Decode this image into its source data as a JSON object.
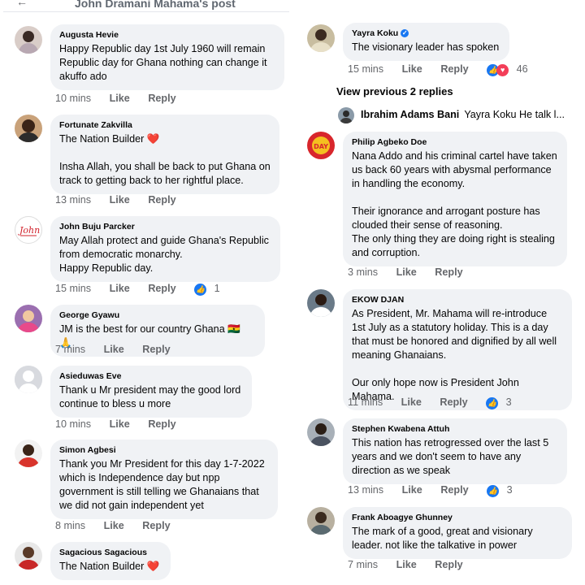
{
  "left_panel": {
    "header_title": "John Dramani Mahama's post",
    "comments": [
      {
        "name": "Augusta Hevie",
        "text": "Happy  Republic  day 1st July  1960 will remain Republic  day for Ghana  nothing  can change it akuffo ado",
        "time": "10 mins",
        "like": "Like",
        "reply": "Reply"
      },
      {
        "name": "Fortunate Zakvilla",
        "text": "The Nation Builder ❤️\n\nInsha Allah, you shall be back to put Ghana on track to getting back to her rightful place.",
        "time": "13 mins",
        "like": "Like",
        "reply": "Reply"
      },
      {
        "name": "John Buju Parcker",
        "text": "May Allah protect and guide Ghana's Republic from democratic monarchy.\nHappy Republic day.",
        "time": "15 mins",
        "like": "Like",
        "reply": "Reply",
        "reactions": "1"
      },
      {
        "name": "George Gyawu",
        "text": "JM is the best for our country Ghana 🇬🇭 🙏",
        "time": "7 mins",
        "like": "Like",
        "reply": "Reply"
      },
      {
        "name": "Asieduwas Eve",
        "text": "Thank u Mr president may the good lord continue to bless u more",
        "time": "10 mins",
        "like": "Like",
        "reply": "Reply"
      },
      {
        "name": "Simon Agbesi",
        "text": "Thank you Mr  President for this day 1-7-2022 which is Independence day but npp government is still telling we Ghanaians that we did not gain independent yet",
        "time": "8 mins",
        "like": "Like",
        "reply": "Reply"
      },
      {
        "name": "Sagacious Sagacious",
        "text": "The Nation Builder ❤️"
      }
    ]
  },
  "right_panel": {
    "comments": [
      {
        "name": "Yayra Koku",
        "verified": "✓",
        "text": "The visionary leader has spoken",
        "time": "15 mins",
        "like": "Like",
        "reply": "Reply",
        "reactions": "46"
      },
      {
        "name": "Philip Agbeko Doe",
        "text": "Nana Addo and his criminal cartel have taken us back 60 years with abysmal performance in handling the economy.\n\nTheir ignorance and arrogant posture has clouded their sense of reasoning.\nThe only thing they are doing right is stealing and corruption.",
        "time": "3 mins",
        "like": "Like",
        "reply": "Reply"
      },
      {
        "name": "EKOW DJAN",
        "text": "As President, Mr. Mahama will re-introduce 1st July as a statutory holiday. This is a day that must be honored and dignified by all well meaning Ghanaians.\n\nOur only hope now is President John Mahama.",
        "time": "11 mins",
        "like": "Like",
        "reply": "Reply",
        "reactions": "3"
      },
      {
        "name": "Stephen Kwabena Attuh",
        "text": "This nation has retrogressed over the last 5 years and we don't seem to have any direction as we speak",
        "time": "13 mins",
        "like": "Like",
        "reply": "Reply",
        "reactions": "3"
      },
      {
        "name": "Frank Aboagye Ghunney",
        "text": "The mark of a good, great and visionary leader. not like the talkative in power",
        "time": "7 mins",
        "like": "Like",
        "reply": "Reply"
      }
    ],
    "view_previous": "View previous 2 replies",
    "reply_preview": {
      "name": "Ibrahim Adams Bani",
      "text": "Yayra Koku He talk l..."
    }
  },
  "icons": {
    "like": "thumbs-up-icon",
    "love": "heart-icon",
    "verified": "verified-badge-icon",
    "back": "back-arrow-icon"
  },
  "colors": {
    "link_blue": "#1877f2",
    "bubble": "#f0f2f5",
    "meta_gray": "#65676b",
    "heart_red": "#f33e58"
  }
}
